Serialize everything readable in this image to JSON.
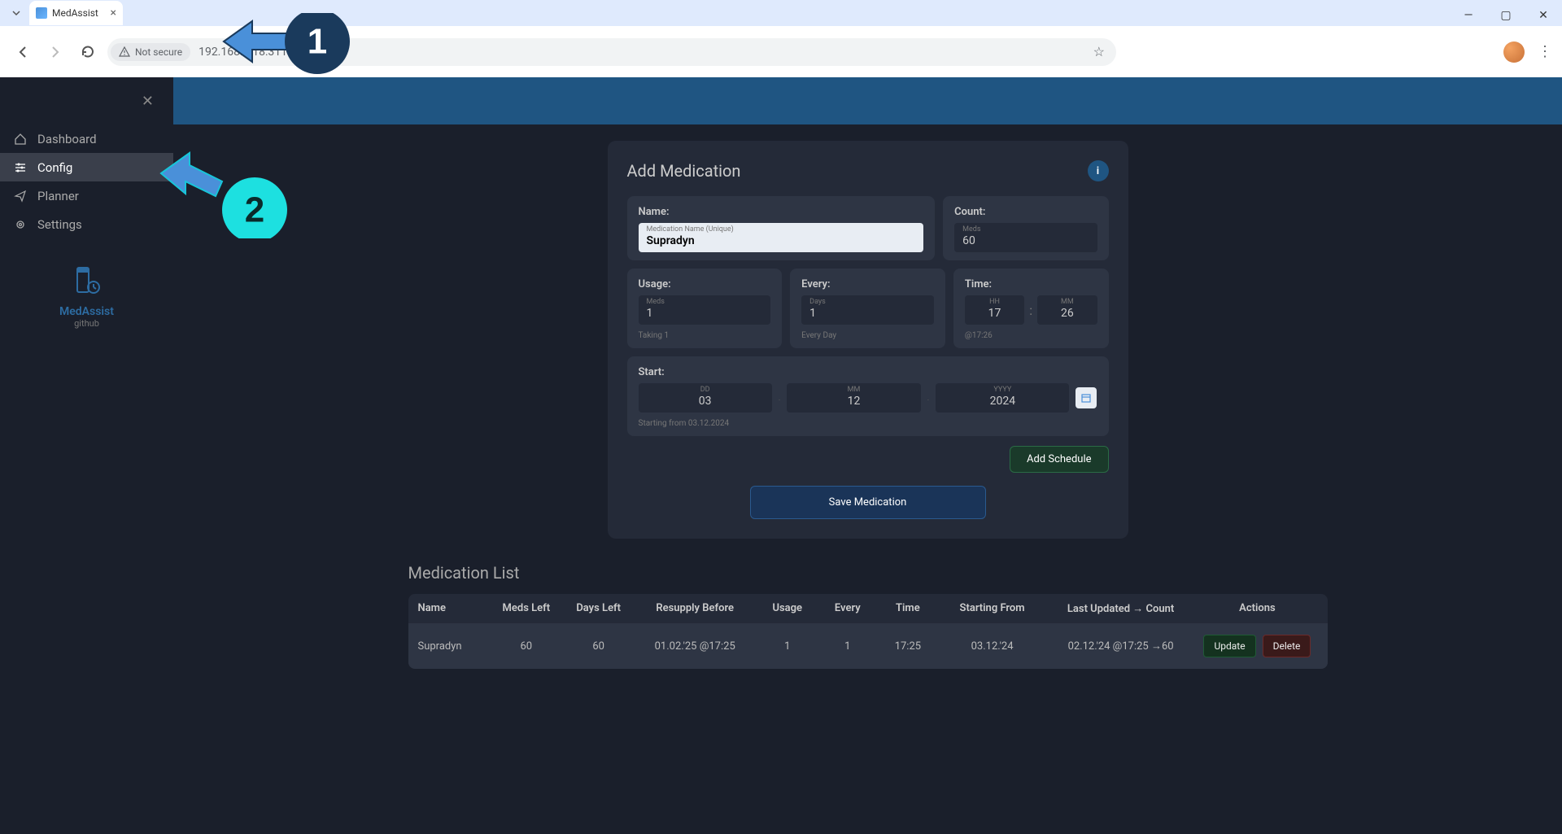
{
  "browser": {
    "tab_title": "MedAssist",
    "security_label": "Not secure",
    "url": "192.168.1.18:3119"
  },
  "sidebar": {
    "items": [
      {
        "label": "Dashboard"
      },
      {
        "label": "Config"
      },
      {
        "label": "Planner"
      },
      {
        "label": "Settings"
      }
    ],
    "brand_name": "MedAssist",
    "brand_sub": "github"
  },
  "panel": {
    "title": "Add Medication",
    "name_label": "Name:",
    "name_placeholder": "Medication Name (Unique)",
    "name_value": "Supradyn",
    "count_label": "Count:",
    "count_sublabel": "Meds",
    "count_value": "60",
    "usage_label": "Usage:",
    "usage_sublabel": "Meds",
    "usage_value": "1",
    "usage_hint": "Taking 1",
    "every_label": "Every:",
    "every_sublabel": "Days",
    "every_value": "1",
    "every_hint": "Every Day",
    "time_label": "Time:",
    "time_hh_label": "HH",
    "time_hh": "17",
    "time_mm_label": "MM",
    "time_mm": "26",
    "time_hint": "@17:26",
    "start_label": "Start:",
    "start_dd_label": "DD",
    "start_dd": "03",
    "start_mm_label": "MM",
    "start_mm": "12",
    "start_yyyy_label": "YYYY",
    "start_yyyy": "2024",
    "start_hint": "Starting from 03.12.2024",
    "add_schedule_btn": "Add Schedule",
    "save_btn": "Save Medication"
  },
  "list": {
    "title": "Medication List",
    "headers": {
      "name": "Name",
      "meds_left": "Meds Left",
      "days_left": "Days Left",
      "resupply": "Resupply Before",
      "usage": "Usage",
      "every": "Every",
      "time": "Time",
      "starting": "Starting From",
      "updated": "Last Updated → Count",
      "actions": "Actions"
    },
    "rows": [
      {
        "name": "Supradyn",
        "meds_left": "60",
        "days_left": "60",
        "resupply": "01.02.'25 @17:25",
        "usage": "1",
        "every": "1",
        "time": "17:25",
        "starting": "03.12.'24",
        "updated": "02.12.'24 @17:25 →60"
      }
    ],
    "update_btn": "Update",
    "delete_btn": "Delete"
  },
  "annotations": {
    "num1": "1",
    "num2": "2"
  }
}
